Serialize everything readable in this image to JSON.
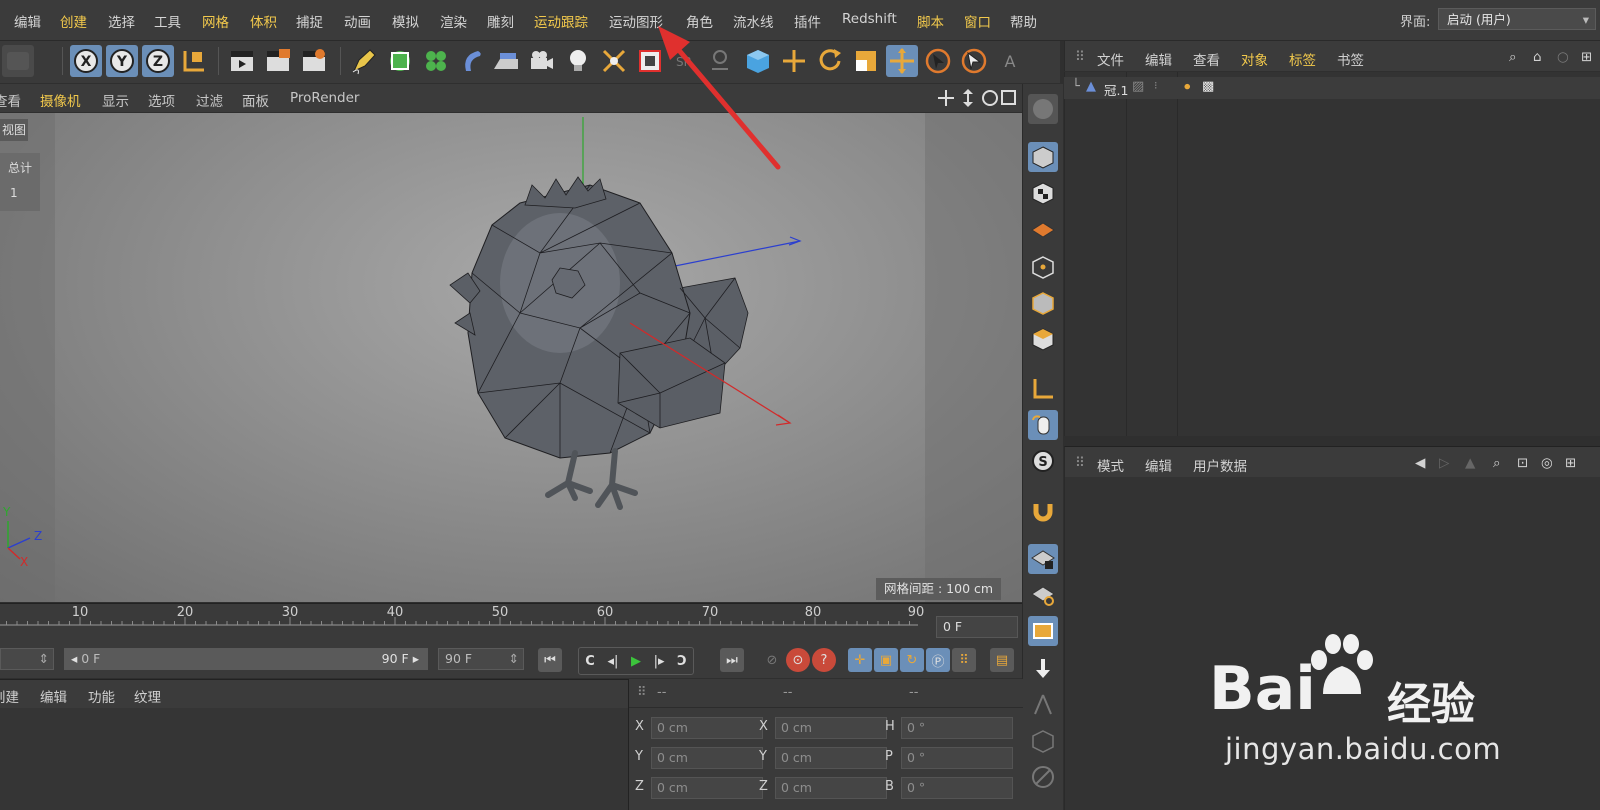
{
  "menubar": {
    "items": [
      "编辑",
      "创建",
      "选择",
      "工具",
      "网格",
      "体积",
      "捕捉",
      "动画",
      "模拟",
      "渲染",
      "雕刻",
      "运动跟踪",
      "运动图形",
      "角色",
      "流水线",
      "插件",
      "Redshift",
      "脚本",
      "窗口",
      "帮助"
    ],
    "layout_label": "界面:",
    "layout_value": "启动 (用户)"
  },
  "toolbar": {
    "axis_x": "X",
    "axis_y": "Y",
    "axis_z": "Z"
  },
  "viewport_menu": {
    "items": [
      "查看",
      "摄像机",
      "显示",
      "选项",
      "过滤",
      "面板",
      "ProRender"
    ]
  },
  "viewport": {
    "view_name": "视图",
    "stats_label": "总计",
    "stats_value": "1",
    "grid_info": "网格间距 : 100 cm",
    "axis_labels": {
      "y": "Y",
      "z": "Z",
      "x": "X"
    }
  },
  "timeline": {
    "ticks": [
      "10",
      "20",
      "30",
      "40",
      "50",
      "60",
      "70",
      "80",
      "90"
    ],
    "current_frame": "0 F",
    "range_start": "0 F",
    "range_end": "90 F",
    "max_frame": "90 F"
  },
  "materials": {
    "menu": [
      "创建",
      "编辑",
      "功能",
      "纹理"
    ]
  },
  "coordinates": {
    "header": [
      "--",
      "--",
      "--"
    ],
    "rows": [
      {
        "a": "X",
        "v1": "0 cm",
        "b": "X",
        "v2": "0 cm",
        "c": "H",
        "v3": "0 °"
      },
      {
        "a": "Y",
        "v1": "0 cm",
        "b": "Y",
        "v2": "0 cm",
        "c": "P",
        "v3": "0 °"
      },
      {
        "a": "Z",
        "v1": "0 cm",
        "b": "Z",
        "v2": "0 cm",
        "c": "B",
        "v3": "0 °"
      }
    ]
  },
  "object_manager": {
    "menu": [
      "文件",
      "编辑",
      "查看",
      "对象",
      "标签",
      "书签"
    ],
    "objects": [
      {
        "name": "冠.1"
      }
    ]
  },
  "attributes": {
    "menu": [
      "模式",
      "编辑",
      "用户数据"
    ]
  },
  "watermark": {
    "brand": "Bai",
    "brand2": "经验",
    "url": "jingyan.baidu.com"
  },
  "colors": {
    "accent_yellow": "#f2c94c",
    "annotation_red": "#e0302e",
    "ui_dark": "#3a3a3a",
    "model_gray": "#5b5f66"
  }
}
